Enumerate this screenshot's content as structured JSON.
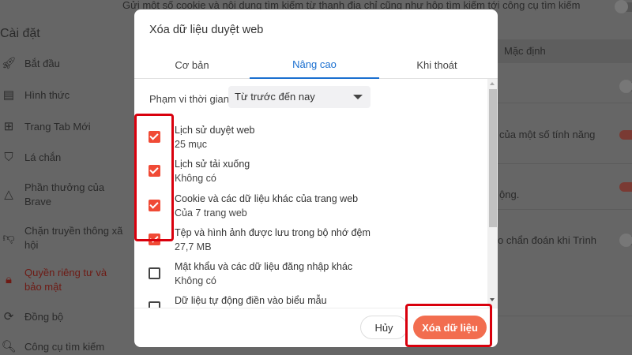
{
  "background": {
    "top_text": "Gửi một số cookie và nội dung tìm kiếm từ thanh địa chỉ cũng như hộp tìm kiếm tới công cụ tìm kiếm",
    "select_value": "Mặc định",
    "row_texts": [
      "của một số tính năng",
      "ộng.",
      "o chẩn đoán khi Trình"
    ]
  },
  "sidebar": {
    "title": "Cài đặt",
    "items": [
      {
        "label": "Bắt đầu",
        "icon": "rocket-icon"
      },
      {
        "label": "Hình thức",
        "icon": "appearance-icon"
      },
      {
        "label": "Trang Tab Mới",
        "icon": "new-tab-icon"
      },
      {
        "label": "Lá chắn",
        "icon": "shield-icon"
      },
      {
        "label": "Phần thưởng của Brave",
        "icon": "rewards-triangle-icon"
      },
      {
        "label": "Chặn truyền thông xã hội",
        "icon": "thumbs-down-icon"
      },
      {
        "label": "Quyền riêng tư và bảo mật",
        "icon": "lock-icon",
        "active": true
      },
      {
        "label": "Đồng bộ",
        "icon": "sync-icon"
      },
      {
        "label": "Công cụ tìm kiếm",
        "icon": "search-icon"
      }
    ]
  },
  "dialog": {
    "title": "Xóa dữ liệu duyệt web",
    "tabs": [
      {
        "label": "Cơ bản"
      },
      {
        "label": "Nâng cao",
        "active": true
      },
      {
        "label": "Khi thoát"
      }
    ],
    "time_range_label": "Phạm vi thời gian",
    "time_range_value": "Từ trước đến nay",
    "items": [
      {
        "label": "Lịch sử duyệt web",
        "sub": "25 mục",
        "checked": true
      },
      {
        "label": "Lịch sử tải xuống",
        "sub": "Không có",
        "checked": true
      },
      {
        "label": "Cookie và các dữ liệu khác của trang web",
        "sub": "Của 7 trang web",
        "checked": true
      },
      {
        "label": "Tệp và hình ảnh được lưu trong bộ nhớ đệm",
        "sub": "27,7 MB",
        "checked": true
      },
      {
        "label": "Mật khẩu và các dữ liệu đăng nhập khác",
        "sub": "Không có",
        "checked": false
      },
      {
        "label": "Dữ liệu tự động điền vào biểu mẫu",
        "sub": "",
        "checked": false
      }
    ],
    "cancel_label": "Hủy",
    "clear_label": "Xóa dữ liệu"
  },
  "colors": {
    "accent": "#f26d4f",
    "checkbox": "#f04a35",
    "tab_active": "#1a6fd0",
    "highlight": "#d9000d"
  }
}
